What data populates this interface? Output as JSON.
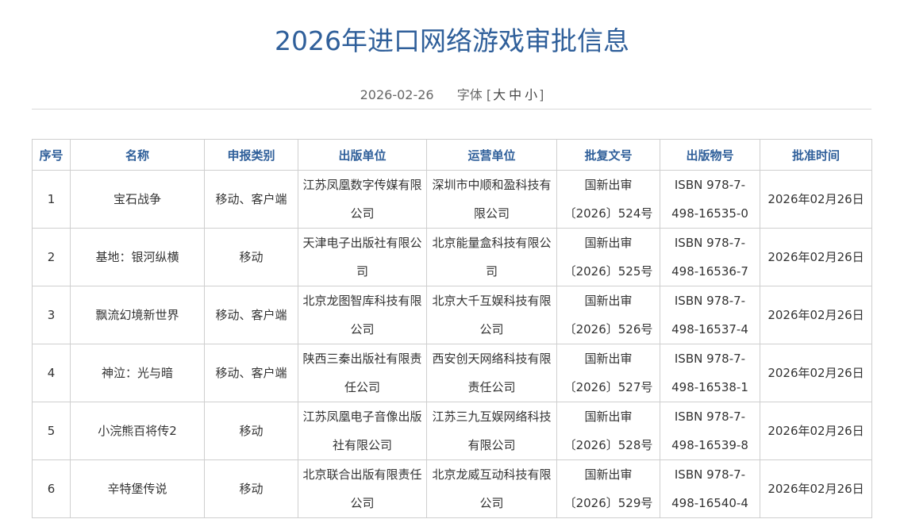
{
  "title": "2026年进口网络游戏审批信息",
  "meta": {
    "date": "2026-02-26",
    "font_label": "字体",
    "bracket_open": "[",
    "bracket_close": "]",
    "large": "大",
    "medium": "中",
    "small": "小"
  },
  "table": {
    "headers": [
      "序号",
      "名称",
      "申报类别",
      "出版单位",
      "运营单位",
      "批复文号",
      "出版物号",
      "批准时间"
    ],
    "rows": [
      {
        "no": "1",
        "name": "宝石战争",
        "category": "移动、客户端",
        "publisher": "江苏凤凰数字传媒有限公司",
        "operator": "深圳市中顺和盈科技有限公司",
        "approval_line1": "国新出审",
        "approval_line2": "〔2026〕524号",
        "isbn_line1": "ISBN 978-7-",
        "isbn_line2": "498-16535-0",
        "date": "2026年02月26日"
      },
      {
        "no": "2",
        "name": "基地：银河纵横",
        "category": "移动",
        "publisher": "天津电子出版社有限公司",
        "operator": "北京能量盒科技有限公司",
        "approval_line1": "国新出审",
        "approval_line2": "〔2026〕525号",
        "isbn_line1": "ISBN 978-7-",
        "isbn_line2": "498-16536-7",
        "date": "2026年02月26日"
      },
      {
        "no": "3",
        "name": "飘流幻境新世界",
        "category": "移动、客户端",
        "publisher": "北京龙图智库科技有限公司",
        "operator": "北京大千互娱科技有限公司",
        "approval_line1": "国新出审",
        "approval_line2": "〔2026〕526号",
        "isbn_line1": "ISBN 978-7-",
        "isbn_line2": "498-16537-4",
        "date": "2026年02月26日"
      },
      {
        "no": "4",
        "name": "神泣：光与暗",
        "category": "移动、客户端",
        "publisher": "陕西三秦出版社有限责任公司",
        "operator": "西安创天网络科技有限责任公司",
        "approval_line1": "国新出审",
        "approval_line2": "〔2026〕527号",
        "isbn_line1": "ISBN 978-7-",
        "isbn_line2": "498-16538-1",
        "date": "2026年02月26日"
      },
      {
        "no": "5",
        "name": "小浣熊百将传2",
        "category": "移动",
        "publisher": "江苏凤凰电子音像出版社有限公司",
        "operator": "江苏三九互娱网络科技有限公司",
        "approval_line1": "国新出审",
        "approval_line2": "〔2026〕528号",
        "isbn_line1": "ISBN 978-7-",
        "isbn_line2": "498-16539-8",
        "date": "2026年02月26日"
      },
      {
        "no": "6",
        "name": "辛特堡传说",
        "category": "移动",
        "publisher": "北京联合出版有限责任公司",
        "operator": "北京龙威互动科技有限公司",
        "approval_line1": "国新出审",
        "approval_line2": "〔2026〕529号",
        "isbn_line1": "ISBN 978-7-",
        "isbn_line2": "498-16540-4",
        "date": "2026年02月26日"
      }
    ]
  },
  "colors": {
    "title": "#2f5f9a",
    "header_text": "#2f5f9a",
    "border": "#cfcfcf",
    "body_text": "#333333"
  }
}
